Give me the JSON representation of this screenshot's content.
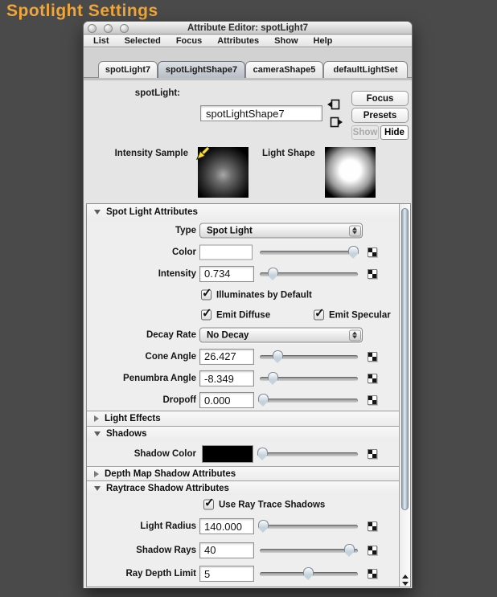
{
  "page": {
    "heading": "Spotlight Settings"
  },
  "colors": {
    "accent": "#f0a638",
    "page_bg": "#4a4a4a",
    "color_swatch": "#ffffff",
    "shadow_color_swatch": "#000000"
  },
  "window": {
    "title": "Attribute Editor: spotLight7",
    "menu": {
      "items": [
        "List",
        "Selected",
        "Focus",
        "Attributes",
        "Show",
        "Help"
      ]
    },
    "tabs": [
      {
        "label": "spotLight7",
        "active": false
      },
      {
        "label": "spotLightShape7",
        "active": true
      },
      {
        "label": "cameraShape5",
        "active": false
      },
      {
        "label": "defaultLightSet",
        "active": false
      }
    ],
    "header": {
      "node_type_label": "spotLight:",
      "node_name": "spotLightShape7",
      "focus_btn": "Focus",
      "presets_btn": "Presets",
      "show_btn": "Show",
      "hide_btn": "Hide",
      "intensity_sample_label": "Intensity Sample",
      "light_shape_label": "Light Shape"
    },
    "attrs": {
      "section_spot": {
        "title": "Spot Light Attributes",
        "expanded": true
      },
      "type": {
        "label": "Type",
        "value": "Spot Light"
      },
      "color": {
        "label": "Color",
        "swatch": "#ffffff",
        "slider_pct": 96
      },
      "intensity": {
        "label": "Intensity",
        "value": "0.734",
        "slider_pct": 14
      },
      "illuminates": {
        "label": "Illuminates by Default",
        "checked": true
      },
      "emit_diffuse": {
        "label": "Emit Diffuse",
        "checked": true
      },
      "emit_specular": {
        "label": "Emit Specular",
        "checked": true
      },
      "decay_rate": {
        "label": "Decay Rate",
        "value": "No Decay"
      },
      "cone_angle": {
        "label": "Cone Angle",
        "value": "26.427",
        "slider_pct": 19
      },
      "penumbra_angle": {
        "label": "Penumbra Angle",
        "value": "-8.349",
        "slider_pct": 14
      },
      "dropoff": {
        "label": "Dropoff",
        "value": "0.000",
        "slider_pct": 4
      },
      "section_light_effects": {
        "title": "Light Effects",
        "expanded": false
      },
      "section_shadows": {
        "title": "Shadows",
        "expanded": true
      },
      "shadow_color": {
        "label": "Shadow Color",
        "swatch": "#000000",
        "slider_pct": 3
      },
      "section_depth_map": {
        "title": "Depth Map Shadow Attributes",
        "expanded": false
      },
      "section_raytrace": {
        "title": "Raytrace Shadow Attributes",
        "expanded": true
      },
      "use_raytrace": {
        "label": "Use Ray Trace Shadows",
        "checked": true
      },
      "light_radius": {
        "label": "Light Radius",
        "value": "140.000",
        "slider_pct": 4
      },
      "shadow_rays": {
        "label": "Shadow Rays",
        "value": "40",
        "slider_pct": 92
      },
      "ray_depth_limit": {
        "label": "Ray Depth Limit",
        "value": "5",
        "slider_pct": 50
      }
    }
  }
}
